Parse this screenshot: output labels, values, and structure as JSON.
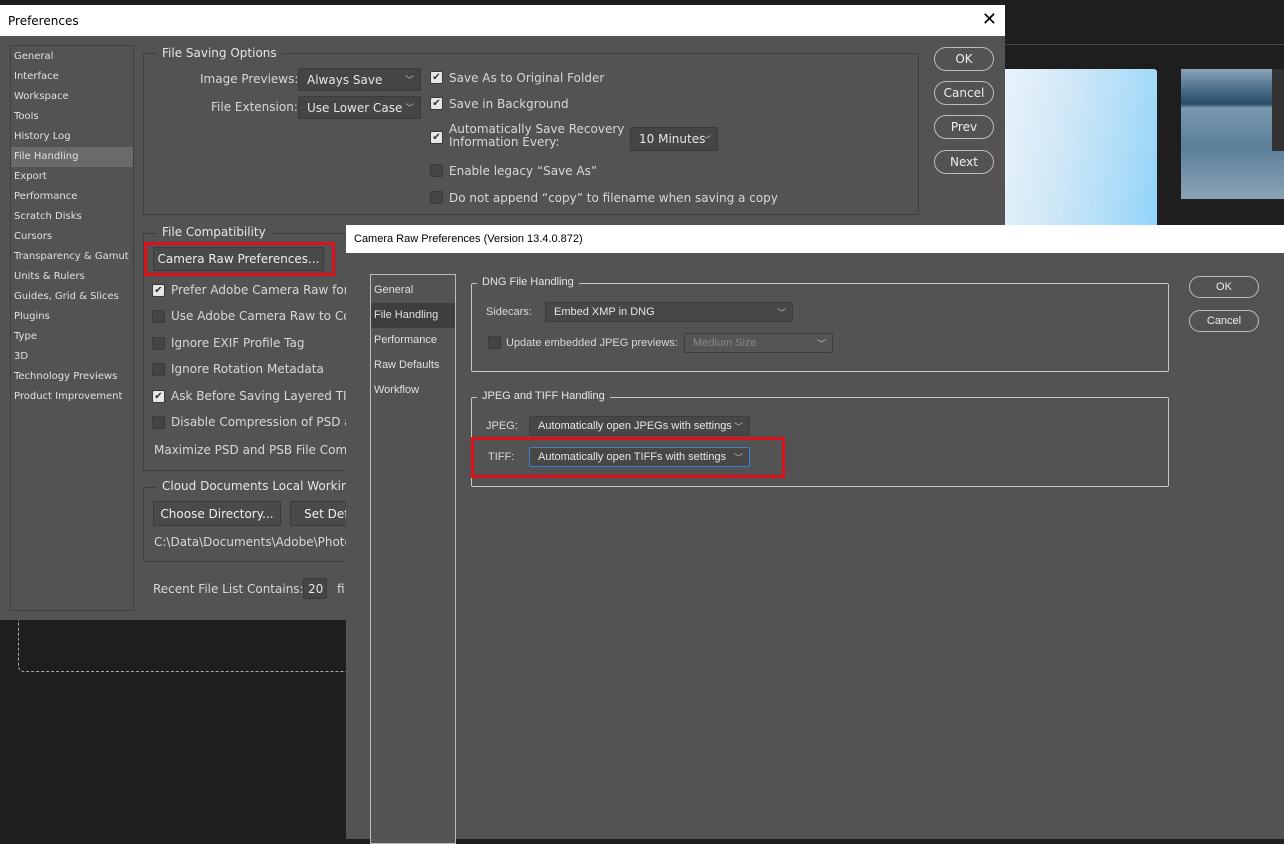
{
  "preferences": {
    "title": "Preferences",
    "sidebar": [
      "General",
      "Interface",
      "Workspace",
      "Tools",
      "History Log",
      "File Handling",
      "Export",
      "Performance",
      "Scratch Disks",
      "Cursors",
      "Transparency & Gamut",
      "Units & Rulers",
      "Guides, Grid & Slices",
      "Plugins",
      "Type",
      "3D",
      "Technology Previews",
      "Product Improvement"
    ],
    "selected": "File Handling",
    "buttons": {
      "ok": "OK",
      "cancel": "Cancel",
      "prev": "Prev",
      "next": "Next"
    },
    "file_saving": {
      "legend": "File Saving Options",
      "image_previews_label": "Image Previews:",
      "image_previews_value": "Always Save",
      "file_extension_label": "File Extension:",
      "file_extension_value": "Use Lower Case",
      "checks": [
        {
          "label": "Save As to Original Folder",
          "checked": true
        },
        {
          "label": "Save in Background",
          "checked": true
        },
        {
          "label": "Automatically Save Recovery",
          "label2": "Information Every:",
          "checked": true
        },
        {
          "label": "Enable legacy “Save As”",
          "checked": false
        },
        {
          "label": "Do not append “copy” to filename when saving a copy",
          "checked": false
        }
      ],
      "recovery_interval": "10 Minutes"
    },
    "compat": {
      "legend": "File Compatibility",
      "camera_raw_button": "Camera Raw Preferences...",
      "checks": [
        {
          "label": "Prefer Adobe Camera Raw for S",
          "checked": true
        },
        {
          "label": "Use Adobe Camera Raw to Conv",
          "checked": false
        },
        {
          "label": "Ignore EXIF Profile Tag",
          "checked": false
        },
        {
          "label": "Ignore Rotation Metadata",
          "checked": false
        },
        {
          "label": "Ask Before Saving Layered TIFF",
          "checked": true
        },
        {
          "label": "Disable Compression of PSD an",
          "checked": false
        }
      ],
      "maximize_label": "Maximize PSD and PSB File Compa"
    },
    "cloud": {
      "legend": "Cloud Documents Local Working",
      "choose_button": "Choose Directory...",
      "set_default_button": "Set Defa",
      "path": "C:\\Data\\Documents\\Adobe\\Photos"
    },
    "recent": {
      "label": "Recent File List Contains:",
      "value": "20",
      "suffix": "fi"
    }
  },
  "camera_raw": {
    "title": "Camera Raw Preferences  (Version 13.4.0.872)",
    "sidebar": [
      "General",
      "File Handling",
      "Performance",
      "Raw Defaults",
      "Workflow"
    ],
    "selected": "File Handling",
    "buttons": {
      "ok": "OK",
      "cancel": "Cancel"
    },
    "dng": {
      "legend": "DNG File Handling",
      "sidecars_label": "Sidecars:",
      "sidecars_value": "Embed XMP in DNG",
      "update_label": "Update embedded JPEG previews:",
      "update_checked": false,
      "update_value": "Medium Size"
    },
    "jpeg_tiff": {
      "legend": "JPEG and TIFF Handling",
      "jpeg_label": "JPEG:",
      "jpeg_value": "Automatically open JPEGs with settings",
      "tiff_label": "TIFF:",
      "tiff_value": "Automatically open TIFFs with settings"
    }
  },
  "colors": {
    "highlight": "#e0101a",
    "dialog_bg": "#535353",
    "focus": "#3f7fd6"
  }
}
